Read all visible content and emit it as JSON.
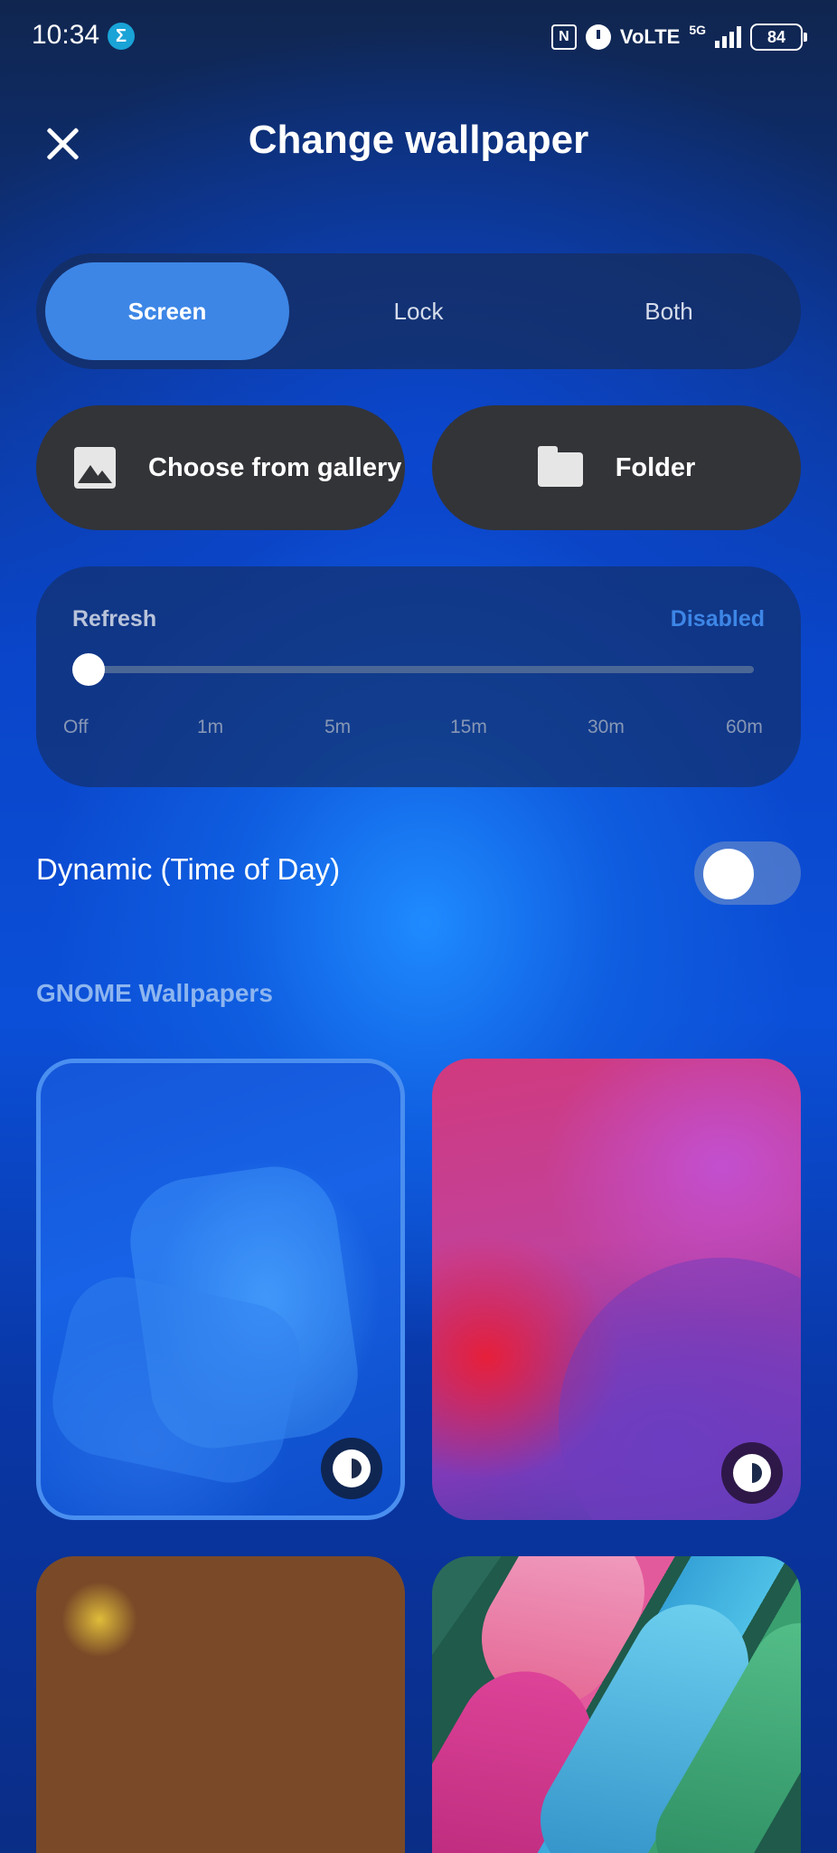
{
  "status_bar": {
    "time": "10:34",
    "app_icon_glyph": "Σ",
    "nfc_glyph": "N",
    "network": "VoLTE",
    "network_gen": "5G",
    "battery": "84"
  },
  "header": {
    "title": "Change wallpaper",
    "close_icon": "close-icon"
  },
  "target_tabs": {
    "items": [
      {
        "label": "Screen",
        "active": true
      },
      {
        "label": "Lock",
        "active": false
      },
      {
        "label": "Both",
        "active": false
      }
    ]
  },
  "sources": {
    "gallery_label": "Choose from gallery",
    "gallery_icon": "image-icon",
    "folder_label": "Folder",
    "folder_icon": "folder-icon"
  },
  "refresh": {
    "label": "Refresh",
    "status": "Disabled",
    "ticks": [
      "Off",
      "1m",
      "5m",
      "15m",
      "30m",
      "60m"
    ],
    "selected": "Off",
    "slider_value": 0
  },
  "dynamic": {
    "label": "Dynamic (Time of Day)",
    "enabled": false
  },
  "gallery": {
    "section_title": "GNOME Wallpapers",
    "badge_icon": "brightness-icon",
    "selected_index": 0
  },
  "colors": {
    "accent": "#3d86e6",
    "card": "#333438"
  }
}
